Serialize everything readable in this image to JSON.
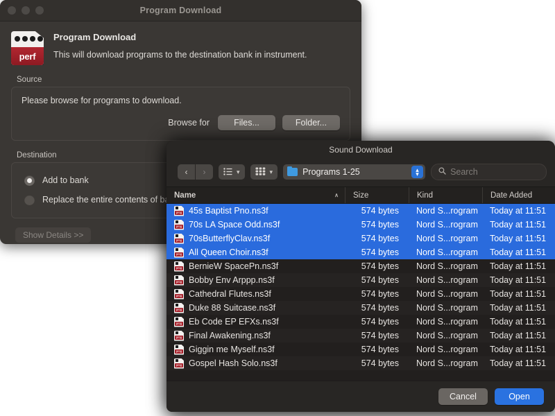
{
  "program_download": {
    "window_title": "Program Download",
    "heading": "Program Download",
    "subheading": "This will download programs to the destination bank in instrument.",
    "icon_label": "perf",
    "source": {
      "group_label": "Source",
      "instruction": "Please browse for programs to download.",
      "browse_label": "Browse for",
      "files_button": "Files...",
      "folder_button": "Folder..."
    },
    "destination": {
      "group_label": "Destination",
      "options": [
        {
          "label": "Add to bank",
          "selected": true
        },
        {
          "label": "Replace the entire contents of bank",
          "selected": false
        }
      ]
    },
    "show_details_button": "Show Details >>"
  },
  "sound_download": {
    "window_title": "Sound Download",
    "toolbar": {
      "back_glyph": "‹",
      "forward_glyph": "›",
      "view_list_icon": "list-view-icon",
      "view_grid_icon": "grid-view-icon",
      "chevron_glyph": "▾",
      "path_label": "Programs 1-25",
      "stepper_up": "▴",
      "stepper_down": "▾",
      "search_placeholder": "Search",
      "search_value": ""
    },
    "columns": [
      {
        "key": "name",
        "label": "Name",
        "sorted": true,
        "sort_caret": "∧"
      },
      {
        "key": "size",
        "label": "Size"
      },
      {
        "key": "kind",
        "label": "Kind"
      },
      {
        "key": "date",
        "label": "Date Added"
      }
    ],
    "files": [
      {
        "name": "45s Baptist Pno.ns3f",
        "size": "574 bytes",
        "kind": "Nord S...rogram",
        "date": "Today at 11:51",
        "selected": true
      },
      {
        "name": "70s LA Space Odd.ns3f",
        "size": "574 bytes",
        "kind": "Nord S...rogram",
        "date": "Today at 11:51",
        "selected": true
      },
      {
        "name": "70sButterflyClav.ns3f",
        "size": "574 bytes",
        "kind": "Nord S...rogram",
        "date": "Today at 11:51",
        "selected": true
      },
      {
        "name": "All Queen Choir.ns3f",
        "size": "574 bytes",
        "kind": "Nord S...rogram",
        "date": "Today at 11:51",
        "selected": true
      },
      {
        "name": "BernieW SpacePn.ns3f",
        "size": "574 bytes",
        "kind": "Nord S...rogram",
        "date": "Today at 11:51",
        "selected": false
      },
      {
        "name": "Bobby Env Arppp.ns3f",
        "size": "574 bytes",
        "kind": "Nord S...rogram",
        "date": "Today at 11:51",
        "selected": false
      },
      {
        "name": "Cathedral Flutes.ns3f",
        "size": "574 bytes",
        "kind": "Nord S...rogram",
        "date": "Today at 11:51",
        "selected": false
      },
      {
        "name": "Duke 88 Suitcase.ns3f",
        "size": "574 bytes",
        "kind": "Nord S...rogram",
        "date": "Today at 11:51",
        "selected": false
      },
      {
        "name": "Eb Code EP EFXs.ns3f",
        "size": "574 bytes",
        "kind": "Nord S...rogram",
        "date": "Today at 11:51",
        "selected": false
      },
      {
        "name": "Final Awakening.ns3f",
        "size": "574 bytes",
        "kind": "Nord S...rogram",
        "date": "Today at 11:51",
        "selected": false
      },
      {
        "name": "Giggin me Myself.ns3f",
        "size": "574 bytes",
        "kind": "Nord S...rogram",
        "date": "Today at 11:51",
        "selected": false
      },
      {
        "name": "Gospel Hash Solo.ns3f",
        "size": "574 bytes",
        "kind": "Nord S...rogram",
        "date": "Today at 11:51",
        "selected": false
      }
    ],
    "file_icon_tag": "prog",
    "footer": {
      "cancel_button": "Cancel",
      "open_button": "Open"
    }
  },
  "colors": {
    "selection_blue": "#2a6bdd",
    "default_button_blue": "#2a72e0",
    "accent_red": "#a51f29",
    "folder_blue": "#3f9ae0"
  }
}
